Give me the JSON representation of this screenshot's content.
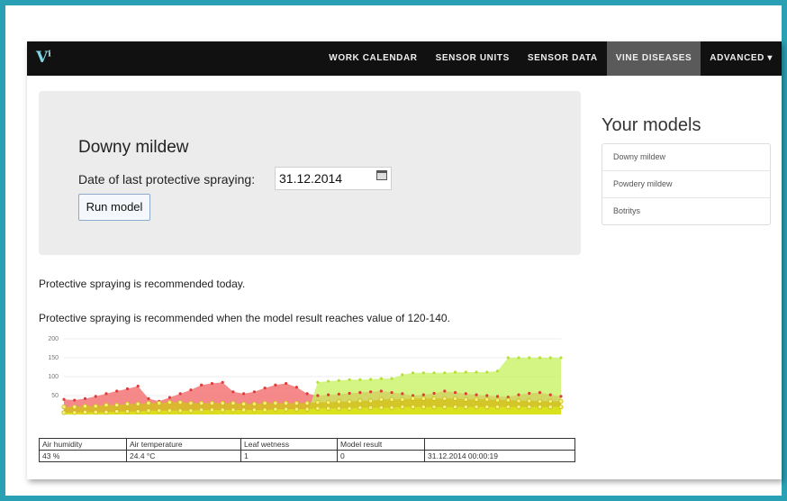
{
  "app": {
    "logo": "V",
    "logo_sup": "i"
  },
  "nav": {
    "items": [
      {
        "label": "WORK CALENDAR"
      },
      {
        "label": "SENSOR UNITS"
      },
      {
        "label": "SENSOR DATA"
      },
      {
        "label": "VINE DISEASES",
        "active": true
      },
      {
        "label": "ADVANCED ▾"
      }
    ]
  },
  "model_panel": {
    "title": "Downy mildew",
    "date_label": "Date of last protective spraying:",
    "date_value": "31.12.2014",
    "run_button": "Run model"
  },
  "your_models": {
    "title": "Your models",
    "items": [
      "Downy mildew",
      "Powdery mildew",
      "Botritys"
    ]
  },
  "messages": {
    "today": "Protective spraying is recommended today.",
    "threshold": "Protective spraying is recommended when the model result reaches value of 120-140."
  },
  "chart_data": {
    "type": "area",
    "yticks": [
      "200",
      "150",
      "100",
      "50"
    ],
    "ylim": [
      0,
      200
    ],
    "series": [
      {
        "color": "#f26b6b",
        "values": [
          40,
          38,
          42,
          48,
          55,
          62,
          68,
          75,
          42,
          35,
          45,
          55,
          65,
          78,
          82,
          85,
          60,
          55,
          60,
          70,
          78,
          82,
          72,
          55,
          50,
          52,
          54,
          56,
          58,
          60,
          62,
          58,
          55,
          50,
          52,
          56,
          62,
          58,
          55,
          52,
          50,
          48,
          46,
          52,
          56,
          58,
          52,
          48
        ]
      },
      {
        "color": "#c6f25a",
        "values": [
          0,
          0,
          0,
          0,
          0,
          0,
          0,
          0,
          0,
          0,
          0,
          0,
          0,
          0,
          0,
          0,
          0,
          0,
          0,
          0,
          0,
          0,
          0,
          0,
          85,
          88,
          90,
          92,
          92,
          93,
          95,
          95,
          105,
          110,
          110,
          110,
          110,
          112,
          112,
          112,
          112,
          115,
          150,
          150,
          150,
          150,
          150,
          150
        ]
      },
      {
        "color": "#d4c21a",
        "values": [
          20,
          20,
          22,
          22,
          25,
          25,
          28,
          28,
          30,
          30,
          32,
          32,
          30,
          30,
          30,
          30,
          30,
          28,
          28,
          30,
          30,
          30,
          30,
          30,
          32,
          32,
          34,
          34,
          36,
          36,
          40,
          40,
          40,
          42,
          42,
          42,
          42,
          42,
          40,
          40,
          40,
          38,
          38,
          36,
          36,
          35,
          35,
          35
        ]
      },
      {
        "color": "#d9e81c",
        "values": [
          5,
          5,
          6,
          6,
          6,
          8,
          8,
          8,
          10,
          10,
          10,
          10,
          10,
          12,
          12,
          12,
          12,
          12,
          12,
          12,
          14,
          14,
          14,
          14,
          16,
          16,
          16,
          16,
          18,
          18,
          18,
          18,
          20,
          20,
          20,
          20,
          20,
          20,
          20,
          20,
          20,
          20,
          20,
          20,
          20,
          20,
          20,
          20
        ]
      }
    ]
  },
  "table": {
    "headers": [
      "Air humidity",
      "Air temperature",
      "Leaf wetness",
      "Model result",
      ""
    ],
    "rows": [
      [
        "43 %",
        "24.4 °C",
        "1",
        "0",
        "31.12.2014 00:00:19"
      ]
    ]
  }
}
